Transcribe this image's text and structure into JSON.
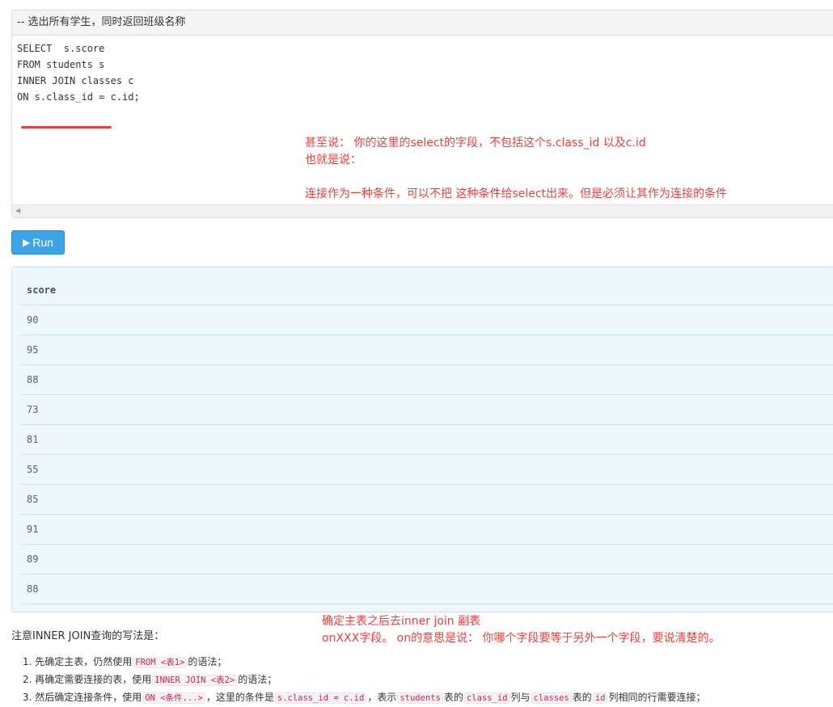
{
  "editor": {
    "header_comment": "-- 选出所有学生，同时返回班级名称",
    "code_lines": [
      "SELECT  s.score",
      "FROM students s",
      "INNER JOIN classes c",
      "ON s.class_id = c.id;"
    ]
  },
  "annotation_top": {
    "line1": "甚至说： 你的这里的select的字段，不包括这个s.class_id  以及c.id",
    "line2": "也就是说：",
    "line3": "连接作为一种条件，可以不把 这种条件给select出来。但是必须让其作为连接的条件"
  },
  "run_button": {
    "icon": "play-icon",
    "label": "Run"
  },
  "result": {
    "columns": [
      "score"
    ],
    "rows": [
      "90",
      "95",
      "88",
      "73",
      "81",
      "55",
      "85",
      "91",
      "89",
      "88"
    ]
  },
  "notes": {
    "intro": "注意INNER JOIN查询的写法是：",
    "annotation_line1": "确定主表之后去inner join 副表",
    "annotation_line2": "onXXX字段。   on的意思是说：  你哪个字段要等于另外一个字段，要说清楚的。",
    "step1": {
      "pre": "1. 先确定主表，仍然使用",
      "code": "FROM <表1>",
      "post": "的语法；"
    },
    "step2": {
      "pre": "2. 再确定需要连接的表，使用",
      "code": "INNER JOIN <表2>",
      "post": "的语法；"
    },
    "step3": {
      "pre": "3. 然后确定连接条件，使用",
      "code1": "ON <条件...>",
      "mid1": "，这里的条件是",
      "code2": "s.class_id = c.id",
      "mid2": "，表示",
      "code3": "students",
      "mid3": "表的",
      "code4": "class_id",
      "mid4": "列与",
      "code5": "classes",
      "mid5": "表的",
      "code6": "id",
      "post": "列相同的行需要连接；"
    }
  },
  "colors": {
    "annotation_red": "#e8413c",
    "run_button": "#3aa6e5",
    "result_background": "#eef7fc",
    "code_inline": "#c7254e"
  }
}
